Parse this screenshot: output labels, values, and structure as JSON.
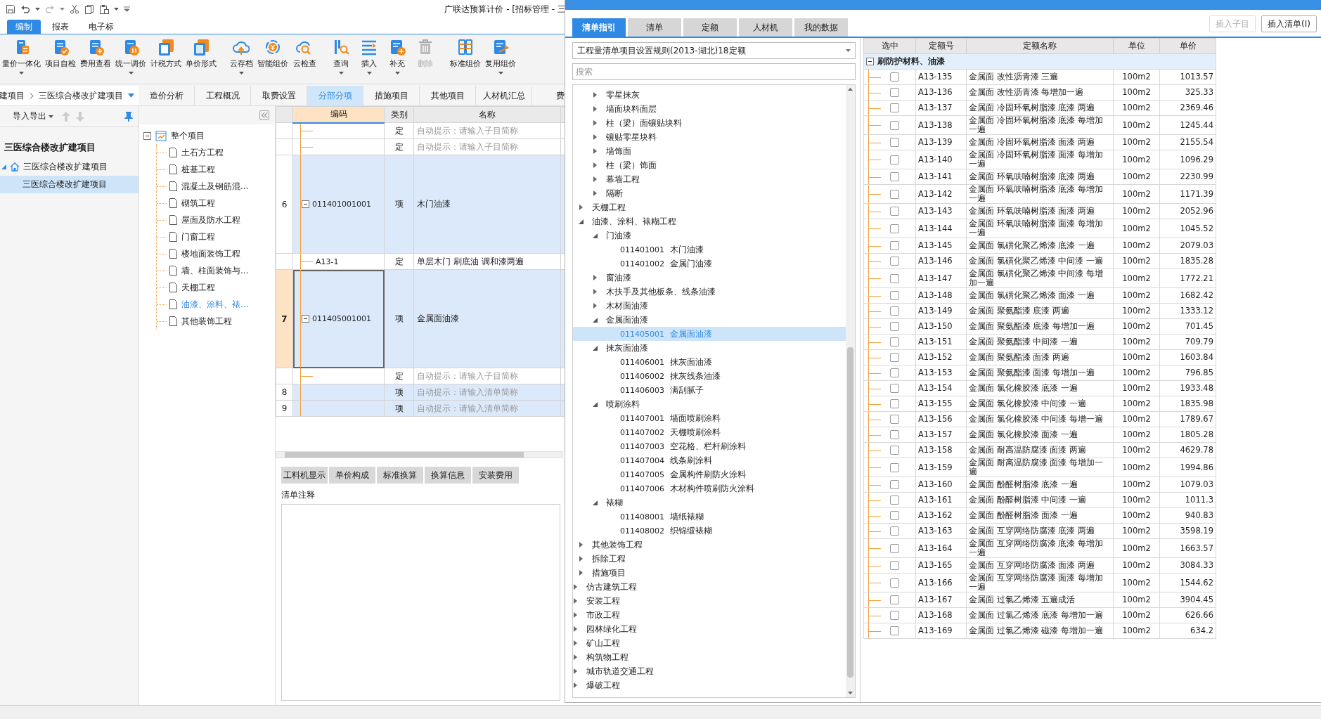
{
  "window": {
    "title": "广联达预算计价 - [招标管理 - 三"
  },
  "ribbon": {
    "tabs": [
      {
        "label": "编制",
        "selected": true
      },
      {
        "label": "报表",
        "selected": false
      },
      {
        "label": "电子标",
        "selected": false
      }
    ],
    "groups": [
      [
        {
          "label": "量价一体化",
          "dropdown": true,
          "disabled": false
        },
        {
          "label": "项目自检",
          "dropdown": false,
          "disabled": false
        },
        {
          "label": "费用查看",
          "dropdown": false,
          "disabled": false
        },
        {
          "label": "统一调价",
          "dropdown": true,
          "disabled": false
        },
        {
          "label": "计税方式",
          "dropdown": false,
          "disabled": false
        },
        {
          "label": "单价形式",
          "dropdown": false,
          "disabled": false
        }
      ],
      [
        {
          "label": "云存档",
          "dropdown": true,
          "disabled": false
        },
        {
          "label": "智能组价",
          "dropdown": false,
          "disabled": false
        },
        {
          "label": "云检查",
          "dropdown": false,
          "disabled": false
        }
      ],
      [
        {
          "label": "查询",
          "dropdown": true,
          "disabled": false
        },
        {
          "label": "插入",
          "dropdown": true,
          "disabled": false
        },
        {
          "label": "补充",
          "dropdown": true,
          "disabled": false
        },
        {
          "label": "删除",
          "dropdown": false,
          "disabled": true
        }
      ],
      [
        {
          "label": "标准组价",
          "dropdown": false,
          "disabled": false
        },
        {
          "label": "复用组价",
          "dropdown": true,
          "disabled": false
        }
      ]
    ]
  },
  "breadcrumb": {
    "parts": [
      "建项目",
      "三医综合楼改扩建项目"
    ]
  },
  "view_tabs": [
    {
      "label": "造价分析",
      "selected": false
    },
    {
      "label": "工程概况",
      "selected": false
    },
    {
      "label": "取费设置",
      "selected": false
    },
    {
      "label": "分部分项",
      "selected": true
    },
    {
      "label": "措施项目",
      "selected": false
    },
    {
      "label": "其他项目",
      "selected": false
    },
    {
      "label": "人材机汇总",
      "selected": false
    },
    {
      "label": "费",
      "selected": false
    }
  ],
  "project_panel": {
    "toolbar": {
      "label": "导入导出"
    },
    "tree": [
      {
        "label": "三医综合楼改扩建项目",
        "selected": false,
        "children": [
          {
            "label": "三医综合楼改扩建项目",
            "selected": false,
            "expanded": true,
            "children": [
              {
                "label": "三医综合楼改扩建项目",
                "selected": true
              }
            ]
          }
        ]
      }
    ]
  },
  "section_tree": {
    "label": "整个项目",
    "expanded": true,
    "children": [
      {
        "label": "土石方工程",
        "selected": false
      },
      {
        "label": "桩基工程",
        "selected": false
      },
      {
        "label": "混凝土及钢筋混...",
        "selected": false
      },
      {
        "label": "砌筑工程",
        "selected": false
      },
      {
        "label": "屋面及防水工程",
        "selected": false
      },
      {
        "label": "门窗工程",
        "selected": false
      },
      {
        "label": "楼地面装饰工程",
        "selected": false
      },
      {
        "label": "墙、柱面装饰与...",
        "selected": false
      },
      {
        "label": "天棚工程",
        "selected": false
      },
      {
        "label": "油漆、涂料、裱...",
        "selected": true
      },
      {
        "label": "其他装饰工程",
        "selected": false
      }
    ]
  },
  "table": {
    "columns": [
      "编码",
      "类别",
      "名称"
    ],
    "rows": [
      {
        "kind": "de",
        "type": "定",
        "name": "自动提示：请输入子目简称",
        "hint": true,
        "selected": false
      },
      {
        "kind": "de",
        "type": "定",
        "name": "自动提示：请输入子目简称",
        "hint": true,
        "selected": false
      },
      {
        "kind": "qd",
        "number": "6",
        "code": "011401001001",
        "expanded": true,
        "type": "项",
        "name": "木门油漆",
        "hint": false,
        "selected": false
      },
      {
        "kind": "de",
        "code": "A13-1",
        "type": "定",
        "name": "单层木门 刷底油 调和漆两遍",
        "hint": false,
        "selected": false
      },
      {
        "kind": "qd",
        "number": "7",
        "code": "011405001001",
        "expanded": true,
        "type": "项",
        "name": "金属面油漆",
        "hint": false,
        "selected": true
      },
      {
        "kind": "de",
        "type": "定",
        "name": "自动提示：请输入子目简称",
        "hint": true,
        "selected": false
      },
      {
        "kind": "qd",
        "number": "8",
        "type": "项",
        "name": "自动提示：请输入清单简称",
        "hint": true,
        "selected": false
      },
      {
        "kind": "qd",
        "number": "9",
        "type": "项",
        "name": "自动提示：请输入清单简称",
        "hint": true,
        "selected": false
      }
    ]
  },
  "detail_tabs": [
    {
      "label": "工料机显示",
      "selected": false
    },
    {
      "label": "单价构成",
      "selected": false
    },
    {
      "label": "标准换算",
      "selected": false
    },
    {
      "label": "换算信息",
      "selected": false
    },
    {
      "label": "安装费用",
      "selected": false
    }
  ],
  "notes": {
    "label": "清单注释"
  },
  "dialog": {
    "tabs": [
      {
        "label": "清单指引",
        "selected": true
      },
      {
        "label": "清单",
        "selected": false
      },
      {
        "label": "定额",
        "selected": false
      },
      {
        "label": "人材机",
        "selected": false
      },
      {
        "label": "我的数据",
        "selected": false
      }
    ],
    "buttons": [
      {
        "label": "插入子目",
        "disabled": true
      },
      {
        "label": "插入清单(I)",
        "disabled": false
      }
    ],
    "library": {
      "value": "工程量清单项目设置规则(2013-湖北)18定额"
    },
    "search": {
      "placeholder": "搜索"
    },
    "tree": [
      {
        "children": [
          {
            "children": [
              {
                "label": "零星抹灰",
                "expanded": false,
                "selected": false
              },
              {
                "label": "墙面块料面层",
                "expanded": false,
                "selected": false
              },
              {
                "label": "柱（梁）面镶贴块料",
                "expanded": false,
                "selected": false
              },
              {
                "label": "镶贴零星块料",
                "expanded": false,
                "selected": false
              },
              {
                "label": "墙饰面",
                "expanded": false,
                "selected": false
              },
              {
                "label": "柱（梁）饰面",
                "expanded": false,
                "selected": false
              },
              {
                "label": "幕墙工程",
                "expanded": false,
                "selected": false
              },
              {
                "label": "隔断",
                "expanded": false,
                "selected": false
              }
            ]
          },
          {
            "label": "天棚工程",
            "expanded": false,
            "selected": false
          },
          {
            "label": "油漆、涂料、裱糊工程",
            "expanded": true,
            "selected": false,
            "children": [
              {
                "label": "门油漆",
                "expanded": true,
                "selected": false,
                "children": [
                  {
                    "code": "011401001",
                    "label": "木门油漆",
                    "selected": false
                  },
                  {
                    "code": "011401002",
                    "label": "金属门油漆",
                    "selected": false
                  }
                ]
              },
              {
                "label": "窗油漆",
                "expanded": false,
                "selected": false
              },
              {
                "label": "木扶手及其他板条、线条油漆",
                "expanded": false,
                "selected": false
              },
              {
                "label": "木材面油漆",
                "expanded": false,
                "selected": false
              },
              {
                "label": "金属面油漆",
                "expanded": true,
                "selected": false,
                "children": [
                  {
                    "code": "011405001",
                    "label": "金属面油漆",
                    "selected": true
                  }
                ]
              },
              {
                "label": "抹灰面油漆",
                "expanded": true,
                "selected": false,
                "children": [
                  {
                    "code": "011406001",
                    "label": "抹灰面油漆",
                    "selected": false
                  },
                  {
                    "code": "011406002",
                    "label": "抹灰线条油漆",
                    "selected": false
                  },
                  {
                    "code": "011406003",
                    "label": "满刮腻子",
                    "selected": false
                  }
                ]
              },
              {
                "label": "喷刷涂料",
                "expanded": true,
                "selected": false,
                "children": [
                  {
                    "code": "011407001",
                    "label": "墙面喷刷涂料",
                    "selected": false
                  },
                  {
                    "code": "011407002",
                    "label": "天棚喷刷涂料",
                    "selected": false
                  },
                  {
                    "code": "011407003",
                    "label": "空花格、栏杆刷涂料",
                    "selected": false
                  },
                  {
                    "code": "011407004",
                    "label": "线条刷涂料",
                    "selected": false
                  },
                  {
                    "code": "011407005",
                    "label": "金属构件刷防火涂料",
                    "selected": false
                  },
                  {
                    "code": "011407006",
                    "label": "木材构件喷刷防火涂料",
                    "selected": false
                  }
                ]
              },
              {
                "label": "裱糊",
                "expanded": true,
                "selected": false,
                "children": [
                  {
                    "code": "011408001",
                    "label": "墙纸裱糊",
                    "selected": false
                  },
                  {
                    "code": "011408002",
                    "label": "织锦缎裱糊",
                    "selected": false
                  }
                ]
              }
            ]
          },
          {
            "label": "其他装饰工程",
            "expanded": false,
            "selected": false
          },
          {
            "label": "拆除工程",
            "expanded": false,
            "selected": false
          },
          {
            "label": "措施项目",
            "expanded": false,
            "selected": false
          }
        ]
      },
      {
        "label": "仿古建筑工程",
        "expanded": false,
        "selected": false
      },
      {
        "label": "安装工程",
        "expanded": false,
        "selected": false
      },
      {
        "label": "市政工程",
        "expanded": false,
        "selected": false
      },
      {
        "label": "园林绿化工程",
        "expanded": false,
        "selected": false
      },
      {
        "label": "矿山工程",
        "expanded": false,
        "selected": false
      },
      {
        "label": "构筑物工程",
        "expanded": false,
        "selected": false
      },
      {
        "label": "城市轨道交通工程",
        "expanded": false,
        "selected": false
      },
      {
        "label": "爆破工程",
        "expanded": false,
        "selected": false
      }
    ],
    "table": {
      "columns": [
        "选中",
        "定额号",
        "定额名称",
        "单位",
        "单价"
      ],
      "group": {
        "label": "刷防护材料、油漆",
        "expanded": true
      },
      "rows": [
        {
          "checked": false,
          "code": "A13-135",
          "name": "金属面 改性沥青漆 三遍",
          "unit": "100m2",
          "price": "1013.57"
        },
        {
          "checked": false,
          "code": "A13-136",
          "name": "金属面 改性沥青漆 每增加一遍",
          "unit": "100m2",
          "price": "325.33"
        },
        {
          "checked": false,
          "code": "A13-137",
          "name": "金属面 冷固环氧树脂漆 底漆 两遍",
          "unit": "100m2",
          "price": "2369.46"
        },
        {
          "checked": false,
          "code": "A13-138",
          "name": "金属面 冷固环氧树脂漆 底漆 每增加一遍",
          "unit": "100m2",
          "price": "1245.44"
        },
        {
          "checked": false,
          "code": "A13-139",
          "name": "金属面 冷固环氧树脂漆 面漆 两遍",
          "unit": "100m2",
          "price": "2155.54"
        },
        {
          "checked": false,
          "code": "A13-140",
          "name": "金属面 冷固环氧树脂漆 面漆 每增加一遍",
          "unit": "100m2",
          "price": "1096.29"
        },
        {
          "checked": false,
          "code": "A13-141",
          "name": "金属面 环氧呋喃树脂漆 底漆 两遍",
          "unit": "100m2",
          "price": "2230.99"
        },
        {
          "checked": false,
          "code": "A13-142",
          "name": "金属面 环氧呋喃树脂漆 底漆 每增加一遍",
          "unit": "100m2",
          "price": "1171.39"
        },
        {
          "checked": false,
          "code": "A13-143",
          "name": "金属面 环氧呋喃树脂漆 面漆 两遍",
          "unit": "100m2",
          "price": "2052.96"
        },
        {
          "checked": false,
          "code": "A13-144",
          "name": "金属面 环氧呋喃树脂漆 面漆 每增加一遍",
          "unit": "100m2",
          "price": "1045.52"
        },
        {
          "checked": false,
          "code": "A13-145",
          "name": "金属面 氯磺化聚乙烯漆 底漆 一遍",
          "unit": "100m2",
          "price": "2079.03"
        },
        {
          "checked": false,
          "code": "A13-146",
          "name": "金属面 氯磺化聚乙烯漆 中间漆 一遍",
          "unit": "100m2",
          "price": "1835.28"
        },
        {
          "checked": false,
          "code": "A13-147",
          "name": "金属面 氯磺化聚乙烯漆 中间漆 每增加一遍",
          "unit": "100m2",
          "price": "1772.21"
        },
        {
          "checked": false,
          "code": "A13-148",
          "name": "金属面 氯磺化聚乙烯漆 面漆 一遍",
          "unit": "100m2",
          "price": "1682.42"
        },
        {
          "checked": false,
          "code": "A13-149",
          "name": "金属面 聚氨酯漆 底漆 两遍",
          "unit": "100m2",
          "price": "1333.12"
        },
        {
          "checked": false,
          "code": "A13-150",
          "name": "金属面 聚氨酯漆 底漆 每增加一遍",
          "unit": "100m2",
          "price": "701.45"
        },
        {
          "checked": false,
          "code": "A13-151",
          "name": "金属面 聚氨酯漆 中间漆 一遍",
          "unit": "100m2",
          "price": "709.79"
        },
        {
          "checked": false,
          "code": "A13-152",
          "name": "金属面 聚氨酯漆 面漆 两遍",
          "unit": "100m2",
          "price": "1603.84"
        },
        {
          "checked": false,
          "code": "A13-153",
          "name": "金属面 聚氨酯漆 面漆 每增加一遍",
          "unit": "100m2",
          "price": "796.85"
        },
        {
          "checked": false,
          "code": "A13-154",
          "name": "金属面 氯化橡胶漆 底漆 一遍",
          "unit": "100m2",
          "price": "1933.48"
        },
        {
          "checked": false,
          "code": "A13-155",
          "name": "金属面 氯化橡胶漆 中间漆 一遍",
          "unit": "100m2",
          "price": "1835.98"
        },
        {
          "checked": false,
          "code": "A13-156",
          "name": "金属面 氯化橡胶漆 中间漆 每增一遍",
          "unit": "100m2",
          "price": "1789.67"
        },
        {
          "checked": false,
          "code": "A13-157",
          "name": "金属面 氯化橡胶漆 面漆 一遍",
          "unit": "100m2",
          "price": "1805.28"
        },
        {
          "checked": false,
          "code": "A13-158",
          "name": "金属面 耐高温防腐漆 面漆 两遍",
          "unit": "100m2",
          "price": "4629.78"
        },
        {
          "checked": false,
          "code": "A13-159",
          "name": "金属面 耐高温防腐漆 面漆 每增加一遍",
          "unit": "100m2",
          "price": "1994.86"
        },
        {
          "checked": false,
          "code": "A13-160",
          "name": "金属面 酚醛树脂漆 底漆 一遍",
          "unit": "100m2",
          "price": "1079.03"
        },
        {
          "checked": false,
          "code": "A13-161",
          "name": "金属面 酚醛树脂漆 中间漆 一遍",
          "unit": "100m2",
          "price": "1011.3"
        },
        {
          "checked": false,
          "code": "A13-162",
          "name": "金属面 酚醛树脂漆 面漆 一遍",
          "unit": "100m2",
          "price": "940.83"
        },
        {
          "checked": false,
          "code": "A13-163",
          "name": "金属面 互穿网络防腐漆 底漆 两遍",
          "unit": "100m2",
          "price": "3598.19"
        },
        {
          "checked": false,
          "code": "A13-164",
          "name": "金属面 互穿网络防腐漆 底漆 每增加一遍",
          "unit": "100m2",
          "price": "1663.57"
        },
        {
          "checked": false,
          "code": "A13-165",
          "name": "金属面 互穿网络防腐漆 面漆 两遍",
          "unit": "100m2",
          "price": "3084.33"
        },
        {
          "checked": false,
          "code": "A13-166",
          "name": "金属面 互穿网络防腐漆 面漆 每增加一遍",
          "unit": "100m2",
          "price": "1544.62"
        },
        {
          "checked": false,
          "code": "A13-167",
          "name": "金属面 过氯乙烯漆 五遍成活",
          "unit": "100m2",
          "price": "3904.45"
        },
        {
          "checked": false,
          "code": "A13-168",
          "name": "金属面 过氯乙烯漆 底漆 每增加一遍",
          "unit": "100m2",
          "price": "626.66"
        },
        {
          "checked": false,
          "code": "A13-169",
          "name": "金属面 过氯乙烯漆 磁漆 每增加一遍",
          "unit": "100m2",
          "price": "634.2"
        }
      ]
    }
  }
}
